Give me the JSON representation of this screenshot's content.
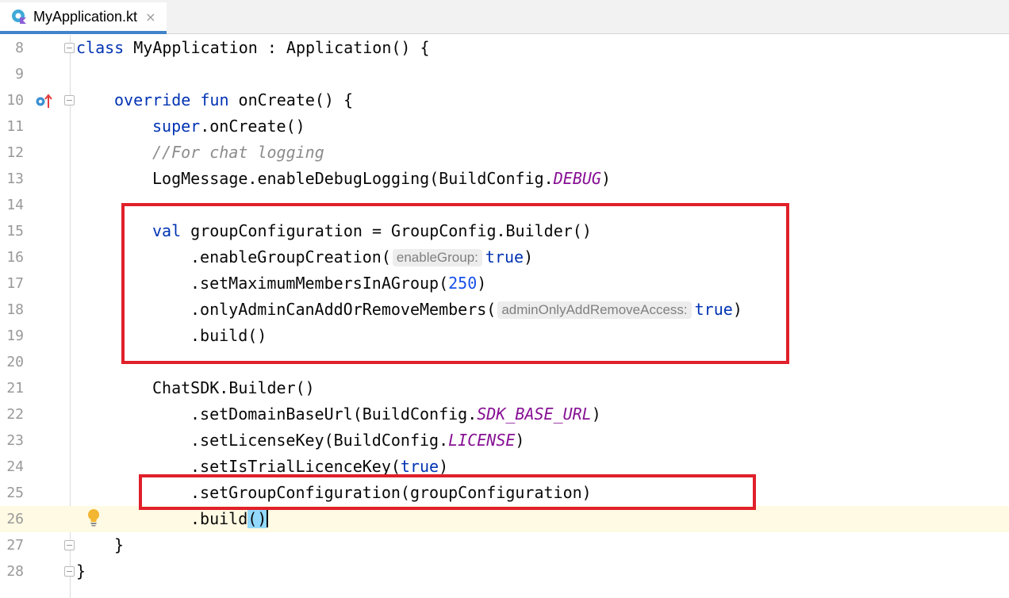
{
  "tab": {
    "title": "MyApplication.kt",
    "close": "×"
  },
  "lines": [
    {
      "n": "8"
    },
    {
      "n": "9"
    },
    {
      "n": "10"
    },
    {
      "n": "11"
    },
    {
      "n": "12"
    },
    {
      "n": "13"
    },
    {
      "n": "14"
    },
    {
      "n": "15"
    },
    {
      "n": "16"
    },
    {
      "n": "17"
    },
    {
      "n": "18"
    },
    {
      "n": "19"
    },
    {
      "n": "20"
    },
    {
      "n": "21"
    },
    {
      "n": "22"
    },
    {
      "n": "23"
    },
    {
      "n": "24"
    },
    {
      "n": "25"
    },
    {
      "n": "26"
    },
    {
      "n": "27"
    },
    {
      "n": "28"
    }
  ],
  "code": {
    "l8": {
      "kw": "class",
      "rest": " MyApplication : Application() {"
    },
    "l10": {
      "kw1": "override",
      "kw2": "fun",
      "rest": " onCreate() {"
    },
    "l11": {
      "kw": "super",
      "rest": ".onCreate()"
    },
    "l12": {
      "comment": "//For chat logging"
    },
    "l13": {
      "pre": "LogMessage.enableDebugLogging(BuildConfig.",
      "const": "DEBUG",
      "post": ")"
    },
    "l15": {
      "kw": "val",
      "rest": " groupConfiguration = GroupConfig.Builder()"
    },
    "l16": {
      "pre": ".enableGroupCreation(",
      "hint": "enableGroup:",
      "kw": "true",
      "post": ")"
    },
    "l17": {
      "pre": ".setMaximumMembersInAGroup(",
      "num": "250",
      "post": ")"
    },
    "l18": {
      "pre": ".onlyAdminCanAddOrRemoveMembers(",
      "hint": "adminOnlyAddRemoveAccess:",
      "kw": "true",
      "post": ")"
    },
    "l19": {
      "text": ".build()"
    },
    "l21": {
      "text": "ChatSDK.Builder()"
    },
    "l22": {
      "pre": ".setDomainBaseUrl(BuildConfig.",
      "const": "SDK_BASE_URL",
      "post": ")"
    },
    "l23": {
      "pre": ".setLicenseKey(BuildConfig.",
      "const": "LICENSE",
      "post": ")"
    },
    "l24": {
      "pre": ".setIsTrialLicenceKey(",
      "kw": "true",
      "post": ")"
    },
    "l25": {
      "text": ".setGroupConfiguration(groupConfiguration)"
    },
    "l26": {
      "pre": ".build",
      "paren": "()"
    },
    "l27": {
      "text": "}"
    },
    "l28": {
      "text": "}"
    }
  },
  "colors": {
    "keyword": "#0033b3",
    "comment": "#8c8c8c",
    "constant": "#871094",
    "number": "#1750eb",
    "highlight_box": "#e0202a",
    "current_line": "#fffae3"
  },
  "icons": [
    "kotlin-file-icon",
    "close-icon",
    "override-icon",
    "fold-icon",
    "lightbulb-icon"
  ]
}
